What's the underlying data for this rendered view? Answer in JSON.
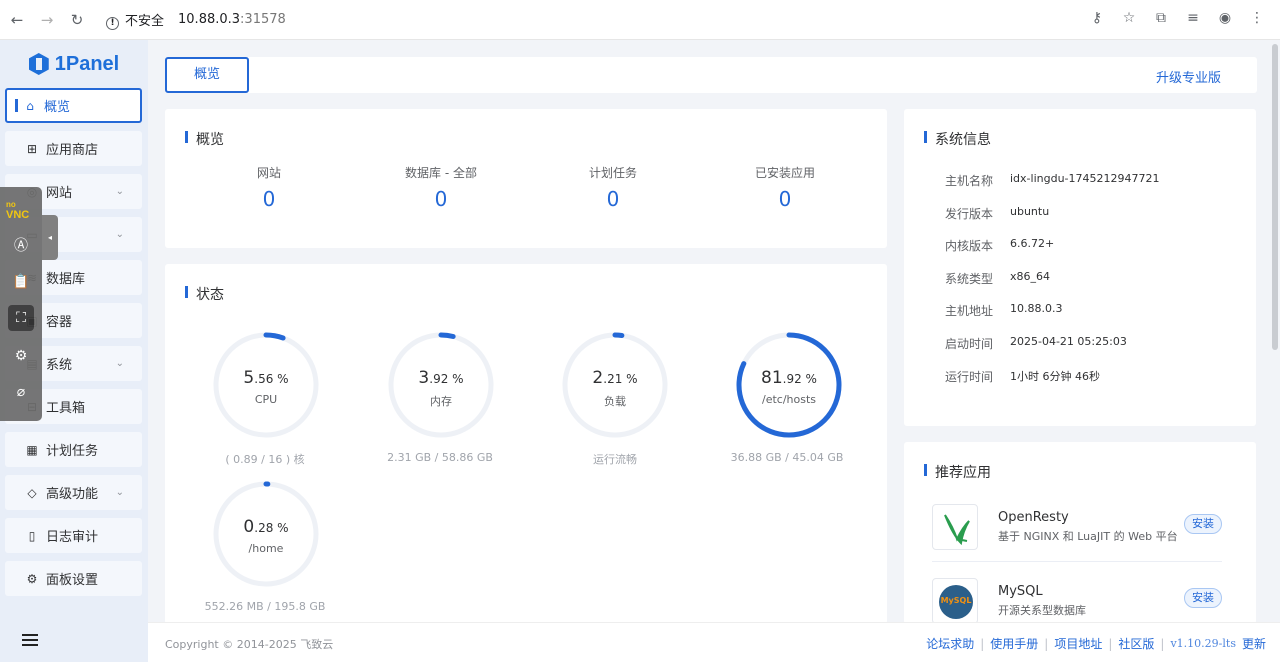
{
  "browser": {
    "insecure_label": "不安全",
    "url_host": "10.88.0.3",
    "url_port": ":31578"
  },
  "sidebar": {
    "logo": "1Panel",
    "items": [
      {
        "label": "概览",
        "icon": "home-icon",
        "active": true
      },
      {
        "label": "应用商店",
        "icon": "grid-icon"
      },
      {
        "label": "网站",
        "icon": "globe-icon",
        "chevron": true
      },
      {
        "label": "",
        "icon": "folder-icon",
        "chevron": true
      },
      {
        "label": "数据库",
        "icon": "database-icon"
      },
      {
        "label": "容器",
        "icon": "container-icon"
      },
      {
        "label": "系统",
        "icon": "system-icon",
        "chevron": true
      },
      {
        "label": "工具箱",
        "icon": "toolbox-icon"
      },
      {
        "label": "计划任务",
        "icon": "calendar-icon"
      },
      {
        "label": "高级功能",
        "icon": "diamond-icon",
        "chevron": true
      },
      {
        "label": "日志审计",
        "icon": "log-icon"
      },
      {
        "label": "面板设置",
        "icon": "gear-icon"
      }
    ]
  },
  "novnc": {
    "logo_top": "no",
    "logo_bottom": "VNC"
  },
  "topbar": {
    "tab_label": "概览",
    "upgrade_label": "升级专业版"
  },
  "overview": {
    "title": "概览",
    "stats": [
      {
        "label": "网站",
        "value": "0"
      },
      {
        "label": "数据库 - 全部",
        "value": "0"
      },
      {
        "label": "计划任务",
        "value": "0"
      },
      {
        "label": "已安装应用",
        "value": "0"
      }
    ]
  },
  "status": {
    "title": "状态",
    "gauges": [
      {
        "int": "5",
        "dec": ".56 %",
        "name": "CPU",
        "sub": "( 0.89 / 16 ) 核",
        "percent": 5.56
      },
      {
        "int": "3",
        "dec": ".92 %",
        "name": "内存",
        "sub": "2.31 GB / 58.86 GB",
        "percent": 3.92
      },
      {
        "int": "2",
        "dec": ".21 %",
        "name": "负载",
        "sub": "运行流畅",
        "percent": 2.21
      },
      {
        "int": "81",
        "dec": ".92 %",
        "name": "/etc/hosts",
        "sub": "36.88 GB / 45.04 GB",
        "percent": 81.92
      },
      {
        "int": "0",
        "dec": ".28 %",
        "name": "/home",
        "sub": "552.26 MB / 195.8 GB",
        "percent": 0.28
      }
    ]
  },
  "sysinfo": {
    "title": "系统信息",
    "rows": [
      {
        "k": "主机名称",
        "v": "idx-lingdu-1745212947721"
      },
      {
        "k": "发行版本",
        "v": "ubuntu"
      },
      {
        "k": "内核版本",
        "v": "6.6.72+"
      },
      {
        "k": "系统类型",
        "v": "x86_64"
      },
      {
        "k": "主机地址",
        "v": "10.88.0.3"
      },
      {
        "k": "启动时间",
        "v": "2025-04-21 05:25:03"
      },
      {
        "k": "运行时间",
        "v": "1小时 6分钟 46秒"
      }
    ]
  },
  "apps": {
    "title": "推荐应用",
    "items": [
      {
        "name": "OpenResty",
        "desc": "基于 NGINX 和 LuaJIT 的 Web 平台",
        "button": "安装",
        "logo_color": "#2a9d4e"
      },
      {
        "name": "MySQL",
        "desc": "开源关系型数据库",
        "button": "安装",
        "logo_color": "#2b5f8a",
        "logo_text": "MySQL"
      }
    ]
  },
  "footer": {
    "copyright": "Copyright © 2014-2025 飞致云",
    "links": [
      "论坛求助",
      "使用手册",
      "项目地址",
      "社区版"
    ],
    "version": "v1.10.29-lts",
    "update": "更新"
  },
  "colors": {
    "accent": "#2468d6",
    "ring": "#eef1f6"
  }
}
